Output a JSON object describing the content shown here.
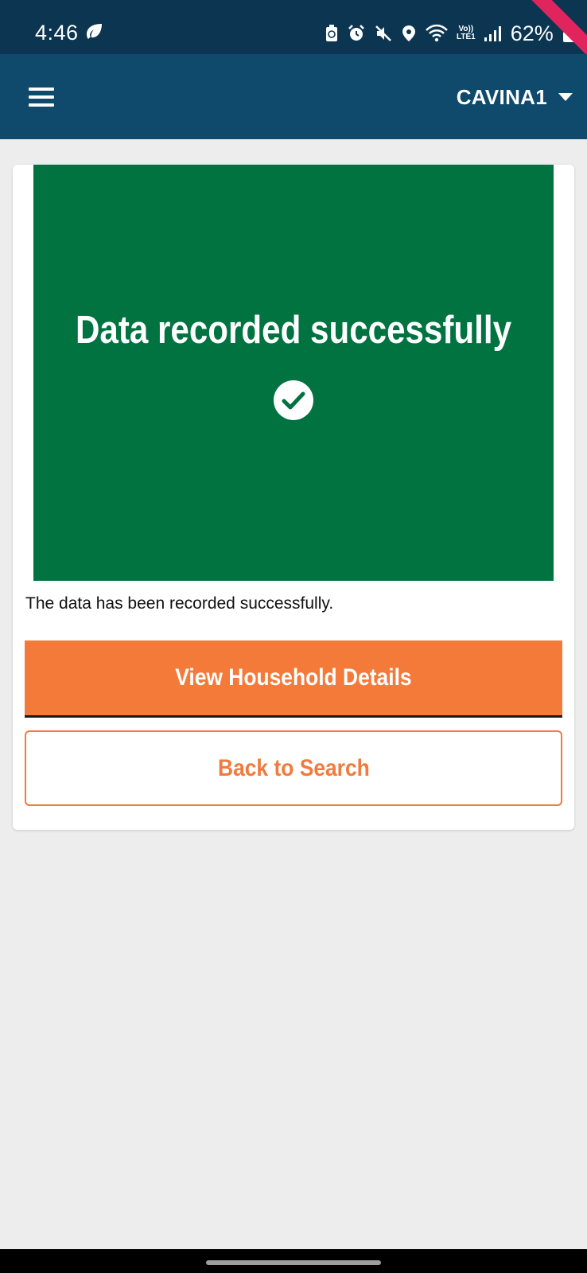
{
  "status_bar": {
    "time": "4:46",
    "lte_top": "Vo))",
    "lte_bottom": "LTE1",
    "battery": "62%"
  },
  "app_bar": {
    "user_name": "CAVINA1"
  },
  "success": {
    "title": "Data recorded successfully",
    "message": "The data has been recorded successfully."
  },
  "actions": {
    "primary_label": "View Household Details",
    "secondary_label": "Back to Search"
  },
  "colors": {
    "status_bar": "#0b3550",
    "app_bar": "#0f4a6d",
    "success_panel": "#007340",
    "accent": "#f47a3a",
    "background": "#ededed"
  },
  "icons": [
    "leaf-icon",
    "battery-saver-icon",
    "alarm-icon",
    "mute-icon",
    "location-icon",
    "wifi-icon",
    "signal-icon",
    "lock-icon",
    "menu-icon",
    "caret-down-icon",
    "check-circle-icon"
  ]
}
